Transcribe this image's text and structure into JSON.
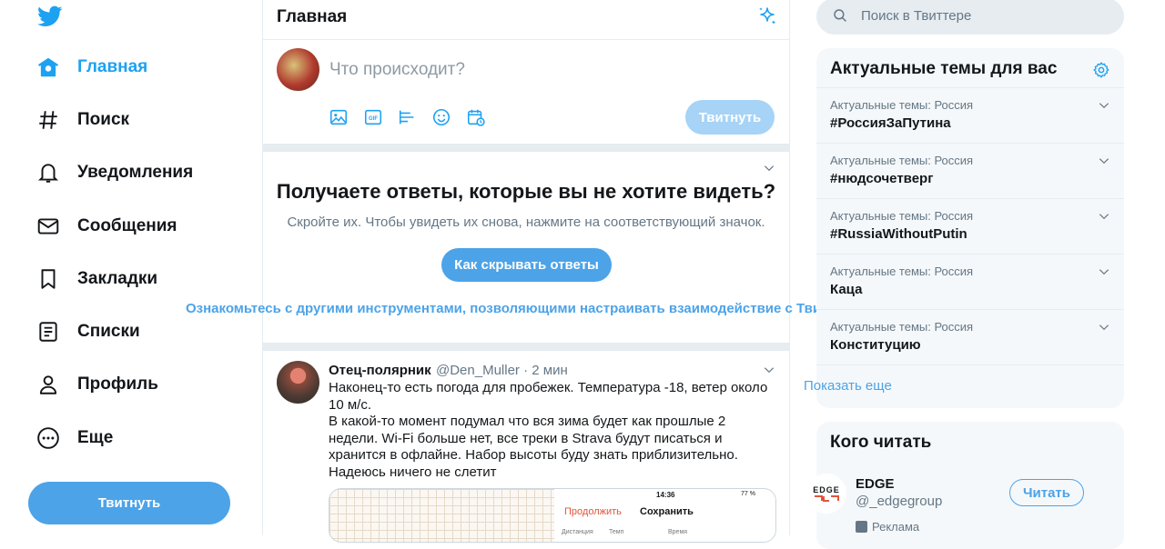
{
  "nav": {
    "items": [
      {
        "label": "Главная",
        "icon": "home-icon",
        "active": true
      },
      {
        "label": "Поиск",
        "icon": "hashtag-icon"
      },
      {
        "label": "Уведомления",
        "icon": "bell-icon"
      },
      {
        "label": "Сообщения",
        "icon": "mail-icon"
      },
      {
        "label": "Закладки",
        "icon": "bookmark-icon"
      },
      {
        "label": "Списки",
        "icon": "list-icon"
      },
      {
        "label": "Профиль",
        "icon": "person-icon"
      },
      {
        "label": "Еще",
        "icon": "more-icon"
      }
    ],
    "tweet_button": "Твитнуть"
  },
  "main": {
    "title": "Главная",
    "compose": {
      "placeholder": "Что происходит?",
      "tweet_button": "Твитнуть",
      "tools": [
        "image-icon",
        "gif-icon",
        "poll-icon",
        "emoji-icon",
        "schedule-icon"
      ]
    },
    "prompt": {
      "title": "Получаете ответы, которые вы не хотите видеть?",
      "subtitle": "Скройте их. Чтобы увидеть их снова, нажмите на соответствующий значок.",
      "button": "Как скрывать ответы"
    },
    "overlay_link": "Ознакомьтесь с другими инструментами, позволяющими настраивать взаимодействие с Твиттером",
    "tweet": {
      "name": "Отец-полярник",
      "meta": "@Den_Muller · 2 мин",
      "text_lines": [
        "Наконец-то есть погода для пробежек. Температура -18, ветер около",
        "10 м/с.",
        "В какой-то момент подумал что вся зима будет как прошлые 2",
        "недели. Wi-Fi больше нет, все треки в Strava будут писаться и",
        "хранится в офлайне. Набор высоты буду знать приблизительно.",
        "Надеюсь ничего не слетит"
      ],
      "media": {
        "time": "14:36",
        "battery": "77 %",
        "continue": "Продолжить",
        "save": "Сохранить",
        "cols": [
          "Дистанция",
          "Темп",
          "Время"
        ]
      }
    }
  },
  "right": {
    "search_placeholder": "Поиск в Твиттере",
    "trends": {
      "title": "Актуальные темы для вас",
      "items": [
        {
          "context": "Актуальные темы: Россия",
          "name": "#РоссияЗаПутина"
        },
        {
          "context": "Актуальные темы: Россия",
          "name": "#нюдсочетверг"
        },
        {
          "context": "Актуальные темы: Россия",
          "name": "#RussiaWithoutPutin"
        },
        {
          "context": "Актуальные темы: Россия",
          "name": "Каца"
        },
        {
          "context": "Актуальные темы: Россия",
          "name": "Конституцию"
        }
      ],
      "show_more": "Показать еще"
    },
    "who_to_follow": {
      "title": "Кого читать",
      "account": {
        "name": "EDGE",
        "handle": "@_edgegroup",
        "follow": "Читать",
        "ad": "Реклама"
      }
    }
  },
  "colors": {
    "accent": "#1da1f2",
    "accent_button": "#4ca3e8",
    "muted": "#657786"
  }
}
